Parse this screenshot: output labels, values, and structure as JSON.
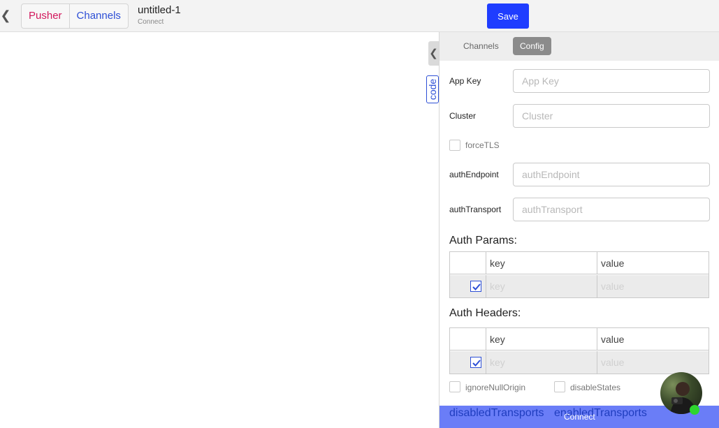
{
  "topbar": {
    "back_icon": "chevron-left-icon",
    "tabs": {
      "pusher": "Pusher",
      "channels": "Channels"
    },
    "doc_title": "untitled-1",
    "doc_subtitle": "Connect",
    "save_label": "Save"
  },
  "code_tab_label": "code",
  "panel": {
    "tabs": {
      "channels": "Channels",
      "config": "Config"
    },
    "fields": {
      "app_key": {
        "label": "App Key",
        "placeholder": "App Key",
        "value": ""
      },
      "cluster": {
        "label": "Cluster",
        "placeholder": "Cluster",
        "value": ""
      },
      "auth_endpoint": {
        "label": "authEndpoint",
        "placeholder": "authEndpoint",
        "value": ""
      },
      "auth_transport": {
        "label": "authTransport",
        "placeholder": "authTransport",
        "value": ""
      }
    },
    "force_tls": {
      "label": "forceTLS",
      "checked": false
    },
    "auth_params": {
      "title": "Auth Params:",
      "headers": {
        "key": "key",
        "value": "value"
      },
      "row": {
        "checked": true,
        "key": "key",
        "value": "value"
      }
    },
    "auth_headers": {
      "title": "Auth Headers:",
      "headers": {
        "key": "key",
        "value": "value"
      },
      "row": {
        "checked": true,
        "key": "key",
        "value": "value"
      }
    },
    "ignore_null_origin": {
      "label": "ignoreNullOrigin",
      "checked": false
    },
    "disable_states": {
      "label": "disableStates",
      "checked": false
    },
    "disabled_transports": "disabledTransports",
    "enabled_transports": "enabledTransports",
    "connect_label": "Connect"
  },
  "colors": {
    "save": "#1f3dff",
    "pusher_tab": "#d2185c",
    "channels_tab": "#2d4fd6",
    "connect_bar": "#6a7df7",
    "online_status": "#2ed52e"
  }
}
